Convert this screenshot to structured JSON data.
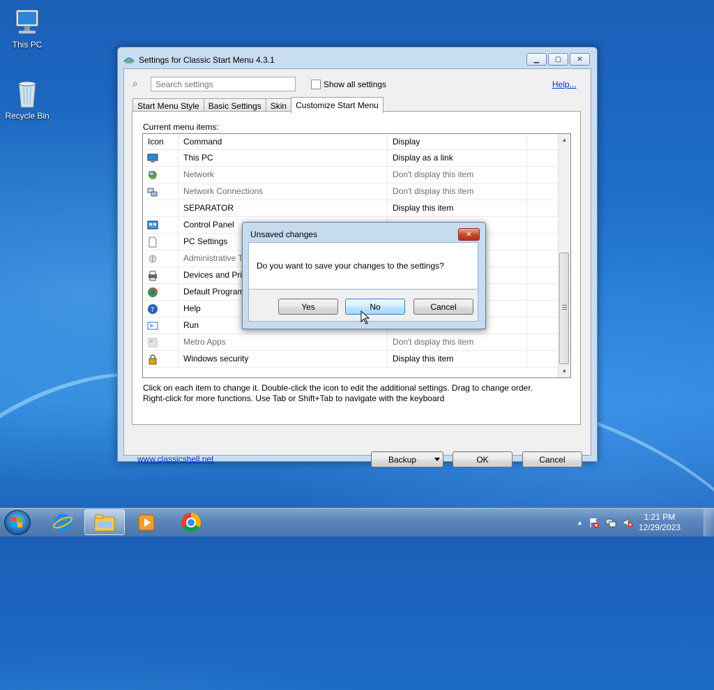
{
  "desktop": {
    "icons": [
      {
        "label": "This PC",
        "icon": "computer-icon"
      },
      {
        "label": "Recycle Bin",
        "icon": "recycle-bin-icon"
      }
    ]
  },
  "window": {
    "title": "Settings for Classic Start Menu 4.3.1",
    "caption_buttons": [
      "minimize",
      "maximize",
      "close"
    ],
    "search_placeholder": "Search settings",
    "show_all_label": "Show all settings",
    "help_link": "Help...",
    "tabs": [
      {
        "label": "Start Menu Style",
        "active": false
      },
      {
        "label": "Basic Settings",
        "active": false
      },
      {
        "label": "Skin",
        "active": false
      },
      {
        "label": "Customize Start Menu",
        "active": true
      }
    ],
    "current_items_label": "Current menu items:",
    "columns": [
      "Icon",
      "Command",
      "Display"
    ],
    "rows": [
      {
        "icon": "computer-icon",
        "command": "This PC",
        "display": "Display as a link",
        "dim": false
      },
      {
        "icon": "network-icon",
        "command": "Network",
        "display": "Don't display this item",
        "dim": true
      },
      {
        "icon": "network-connections-icon",
        "command": "Network Connections",
        "display": "Don't display this item",
        "dim": true
      },
      {
        "icon": "",
        "command": "SEPARATOR",
        "display": "Display this item",
        "dim": false
      },
      {
        "icon": "control-panel-icon",
        "command": "Control Panel",
        "display": "",
        "dim": false
      },
      {
        "icon": "document-icon",
        "command": "PC Settings",
        "display": "",
        "dim": false
      },
      {
        "icon": "admin-tools-icon",
        "command": "Administrative T",
        "display": "",
        "dim": true
      },
      {
        "icon": "printer-icon",
        "command": "Devices and Prin",
        "display": "",
        "dim": false
      },
      {
        "icon": "default-programs-icon",
        "command": "Default Program",
        "display": "",
        "dim": false
      },
      {
        "icon": "help-icon",
        "command": "Help",
        "display": "",
        "dim": false
      },
      {
        "icon": "run-icon",
        "command": "Run",
        "display": "",
        "dim": false
      },
      {
        "icon": "metro-apps-icon",
        "command": "Metro Apps",
        "display": "Don't display this item",
        "dim": true
      },
      {
        "icon": "lock-icon",
        "command": "Windows security",
        "display": "Display this item",
        "dim": false
      }
    ],
    "hint_line1": "Click on each item to change it. Double-click the icon to edit the additional settings. Drag to change order.",
    "hint_line2": "Right-click for more functions. Use Tab or Shift+Tab to navigate with the keyboard",
    "site_link": "www.classicshell.net",
    "backup_label": "Backup",
    "ok_label": "OK",
    "cancel_label": "Cancel"
  },
  "dialog": {
    "title": "Unsaved changes",
    "close_label": "✕",
    "message": "Do you want to save your changes to the settings?",
    "yes_label": "Yes",
    "no_label": "No",
    "cancel_label": "Cancel"
  },
  "taskbar": {
    "time": "1:21 PM",
    "date": "12/29/2023",
    "pinned": [
      "internet-explorer-icon",
      "file-explorer-icon",
      "media-player-icon",
      "chrome-icon"
    ],
    "tray_icons": [
      "show-hidden-icons",
      "action-center-icon",
      "network-tray-icon",
      "volume-muted-icon"
    ],
    "colors": {
      "accent": "#1f72cc",
      "taskbar": "#5d87bd"
    }
  }
}
